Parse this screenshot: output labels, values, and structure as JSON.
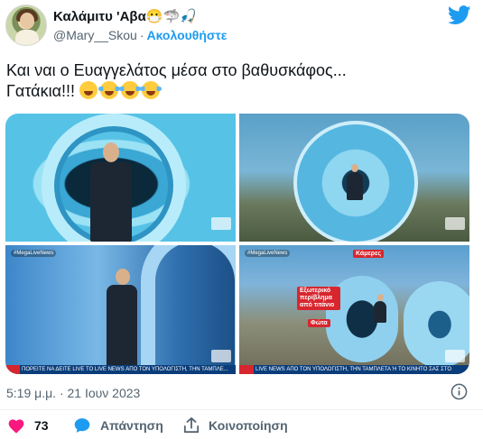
{
  "author": {
    "display_name": "Καλάμιτυ 'Αβα😷🦈🎣",
    "handle": "@Mary__Skou",
    "separator": "·",
    "follow_label": "Ακολουθήστε"
  },
  "tweet": {
    "text_line1": "Και ναι ο Ευαγγελάτος μέσα στο βαθυσκάφος...",
    "text_line2": "Γατάκια!!!",
    "emojis": [
      "zany-face-emoji",
      "tears-of-joy-emoji",
      "tears-of-joy-emoji",
      "tears-of-joy-emoji"
    ]
  },
  "media": {
    "tiles": [
      {
        "hashtag": "",
        "ticker": ""
      },
      {
        "hashtag": "",
        "ticker": ""
      },
      {
        "hashtag": "#MegaLiveNews",
        "ticker": "ΠΟΡΕΙΤΕ ΝΑ ΔΕΙΤΕ LIVE ΤΟ LIVE NEWS ΑΠΟ ΤΟΝ ΥΠΟΛΟΓΙΣΤΗ, ΤΗΝ ΤΑΜΠΛΕ..."
      },
      {
        "hashtag": "#MegaLiveNews",
        "ticker": "LIVE NEWS ΑΠΟ ΤΟΝ ΥΠΟΛΟΓΙΣΤΗ, ΤΗΝ ΤΑΜΠΛΕΤΑ Ή ΤΟ ΚΙΝΗΤΟ ΣΑΣ ΣΤΟ",
        "tags": [
          "Κάμερες",
          "Εξωτερικό περίβλημα από τιτάνιο",
          "Φώτα"
        ]
      }
    ]
  },
  "meta": {
    "timestamp": "5:19 μ.μ. · 21 Ιουν 2023"
  },
  "actions": {
    "like_count": "73",
    "reply_label": "Απάντηση",
    "share_label": "Κοινοποίηση"
  },
  "colors": {
    "accent": "#1d9bf0",
    "like": "#f91880",
    "text_primary": "#0f1419",
    "text_secondary": "#536471"
  }
}
